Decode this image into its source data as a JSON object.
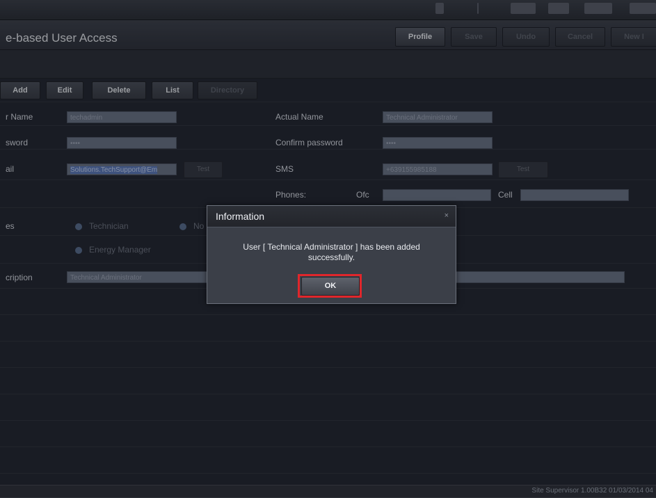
{
  "title": "e-based User Access",
  "toolbar": {
    "profile": "Profile",
    "save": "Save",
    "undo": "Undo",
    "cancel": "Cancel",
    "new": "New I"
  },
  "actions": {
    "add": "Add",
    "edit": "Edit",
    "delete": "Delete",
    "list": "List",
    "directory": "Directory"
  },
  "form": {
    "user_name_label": "r Name",
    "user_name_value": "techadmin",
    "actual_name_label": "Actual Name",
    "actual_name_value": "Technical Administrator",
    "password_label": "sword",
    "password_value": "••••",
    "confirm_password_label": "Confirm password",
    "confirm_password_value": "••••",
    "email_label": "ail",
    "email_value": "Solutions.TechSupport@Em",
    "email_test": "Test",
    "sms_label": "SMS",
    "sms_value": "+639155985188",
    "sms_test": "Test",
    "phones_label": "Phones:",
    "ofc_label": "Ofc",
    "cell_label": "Cell",
    "roles_label": "es",
    "role_technician": "Technician",
    "role_no": "No",
    "role_energy_manager": "Energy Manager",
    "description_label": "cription",
    "description_value": "Technical Administrator"
  },
  "dialog": {
    "title": "Information",
    "close": "×",
    "message": "User [ Technical Administrator ] has been added successfully.",
    "ok": "OK"
  },
  "status": "Site Supervisor 1.00B32 01/03/2014 04"
}
